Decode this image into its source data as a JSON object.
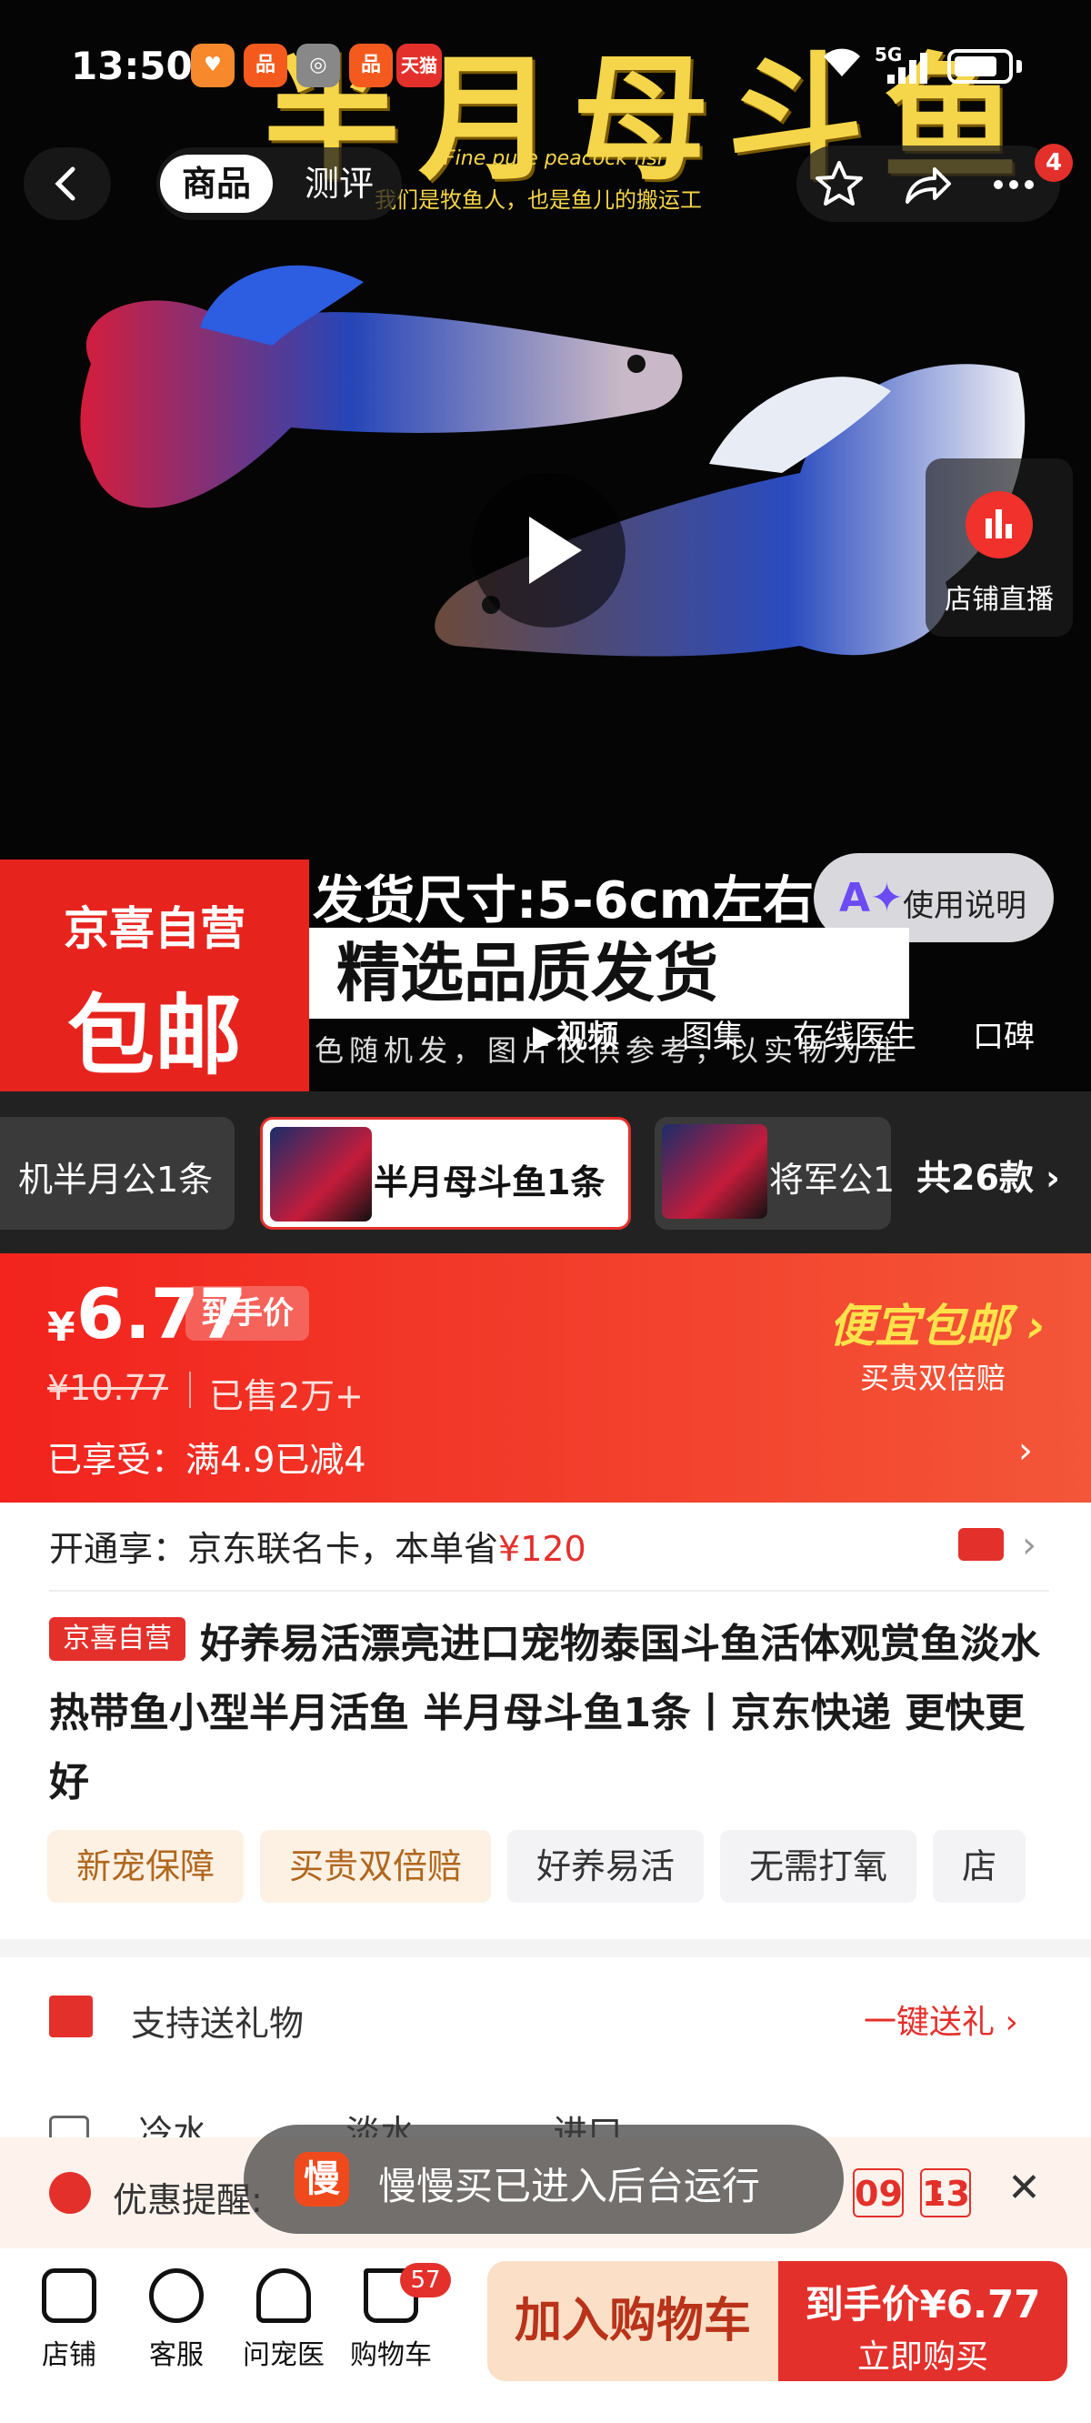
{
  "status_bar": {
    "time": "13:50",
    "network": "5G",
    "tmall_badge": "天猫"
  },
  "hero": {
    "logo_title": "半月母斗鱼",
    "logo_subtitle": "Fine pure peacock fish",
    "logo_tagline": "我们是牧鱼人，也是鱼儿的搬运工",
    "ship_size": "发货尺寸:5-6cm左右",
    "quality": "精选品质发货",
    "disclaimer": "色随机发，图片仅供参考，以实物为准",
    "self_op_line1": "京喜自营",
    "self_op_line2": "包邮",
    "usage_label": "使用说明",
    "live_label": "店铺直播",
    "more_badge": "4"
  },
  "top_nav": {
    "tabs": [
      {
        "label": "商品"
      },
      {
        "label": "测评"
      }
    ]
  },
  "media_tabs": [
    "视频",
    "图集",
    "在线医生",
    "口碑"
  ],
  "variants": {
    "items": [
      "机半月公1条",
      "半月母斗鱼1条",
      "将军公1"
    ],
    "total": "共26款"
  },
  "price": {
    "currency": "¥",
    "current": "6.77",
    "tag": "到手价",
    "original": "¥10.77",
    "sold": "已售2万+",
    "enjoyed": "已享受：满4.9已减4",
    "promo_title": "便宜包邮",
    "promo_sub": "买贵双倍赔"
  },
  "card_offer": {
    "prefix": "开通享：京东联名卡，本单省",
    "amount": "¥120"
  },
  "product": {
    "self_tag": "京喜自营",
    "title": "好养易活漂亮进口宠物泰国斗鱼活体观赏鱼淡水热带鱼小型半月活鱼 半月母斗鱼1条丨京东快递 更快更好",
    "chips": [
      "新宠保障",
      "买贵双倍赔",
      "好养易活",
      "无需打氧",
      "店"
    ]
  },
  "gift": {
    "label": "支持送礼物",
    "action": "一键送礼"
  },
  "specs": [
    "冷水",
    "淡水",
    "进口"
  ],
  "reminder": {
    "label": "优惠提醒:",
    "countdown_min": "09",
    "countdown_sec": "13"
  },
  "toast": {
    "icon_text": "慢",
    "text": "慢慢买已进入后台运行"
  },
  "bottom_bar": {
    "items": [
      {
        "label": "店铺"
      },
      {
        "label": "客服"
      },
      {
        "label": "问宠医"
      },
      {
        "label": "购物车"
      }
    ],
    "cart_count": "57",
    "add_to_cart": "加入购物车",
    "buy_price": "到手价¥6.77",
    "buy_now": "立即购买"
  },
  "colors": {
    "brand_red": "#e4302b",
    "promo_yellow": "#ffe34b",
    "logo_gold": "#f5d54a"
  }
}
